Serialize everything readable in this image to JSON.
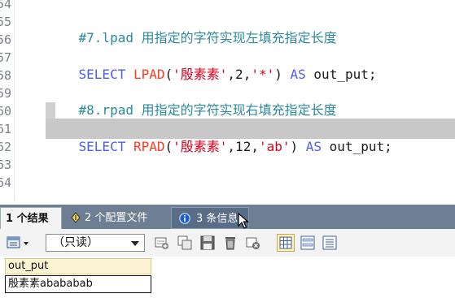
{
  "editor": {
    "line_numbers": [
      "54",
      "55",
      "56",
      "57",
      "58",
      "59",
      "60",
      "61",
      "62",
      "63",
      "64"
    ],
    "lines": [
      {
        "comment": "#7.lpad 用指定的字符实现左填充指定长度"
      },
      {
        "kw1": "SELECT",
        "fn": "LPAD",
        "open": "(",
        "s1": "'殷素素'",
        "c1": ",2,",
        "s2": "'*'",
        "close": ")",
        "kw2": "AS",
        "tail": "out_put;"
      },
      {
        "comment": "#8.rpad 用指定的字符实现右填充指定长度"
      },
      {
        "kw1": "SELECT",
        "fn": "RPAD",
        "open": "(",
        "s1": "'殷素素'",
        "c1": ",12,",
        "s2": "'ab'",
        "close": ")",
        "kw2": "AS",
        "tail": "out_put;"
      }
    ]
  },
  "tabs": [
    {
      "label": "1 个结果",
      "icon": "results-grid-icon",
      "active": true
    },
    {
      "label": "2 个配置文件",
      "icon": "profile-icon",
      "active": false
    },
    {
      "label": "3 条信息",
      "icon": "info-icon",
      "active": false
    }
  ],
  "toolbar": {
    "mode_select": "（只读）",
    "buttons": [
      "export-icon",
      "add-row-icon",
      "duplicate-row-icon",
      "save-icon",
      "delete-icon",
      "cancel-icon",
      "grid-view-icon",
      "form-view-icon",
      "text-view-icon"
    ]
  },
  "results": {
    "columns": [
      "out_put"
    ],
    "rows": [
      [
        "殷素素abababab"
      ]
    ]
  },
  "colors": {
    "keyword": "#4a5df2",
    "function": "#ff3a1f",
    "string": "#d4001c",
    "comment": "#2a8a9c",
    "tabstrip": "#6f7f93",
    "header_cell": "#fcf3d2"
  }
}
